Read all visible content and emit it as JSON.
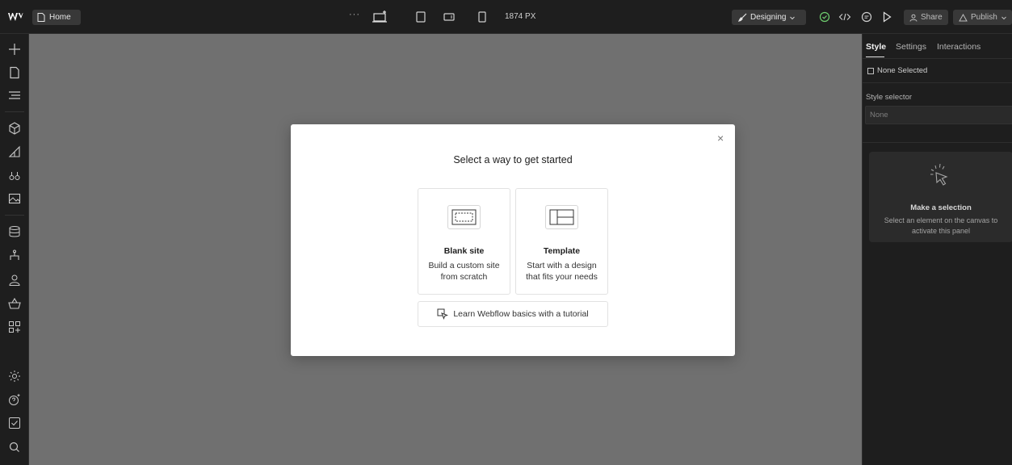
{
  "topbar": {
    "page_label": "Home",
    "more_label": "···",
    "viewport_width": "1874 PX",
    "mode_label": "Designing",
    "share_label": "Share",
    "publish_label": "Publish"
  },
  "modal": {
    "title": "Select a way to get started",
    "close_glyph": "×",
    "options": [
      {
        "title": "Blank site",
        "desc_line1": "Build a custom site",
        "desc_line2": "from scratch"
      },
      {
        "title": "Template",
        "desc_line1": "Start with a design",
        "desc_line2": "that fits your needs"
      }
    ],
    "tutorial_label": "Learn Webflow basics with a tutorial"
  },
  "right_panel": {
    "tabs": [
      "Style",
      "Settings",
      "Interactions"
    ],
    "none_selected": "None Selected",
    "style_selector_label": "Style selector",
    "style_selector_value": "None",
    "empty_title": "Make a selection",
    "empty_desc": "Select an element on the canvas to activate this panel"
  },
  "icons": {
    "left_sidebar": [
      "add-icon",
      "pages-icon",
      "navigator-icon",
      "components-icon",
      "styles-icon",
      "variables-icon",
      "assets-icon",
      "cms-icon",
      "logic-icon",
      "users-icon",
      "ecommerce-icon",
      "apps-icon",
      "settings-icon",
      "help-icon",
      "audit-icon",
      "search-icon"
    ]
  },
  "colors": {
    "canvas": "#707070",
    "chrome": "#1e1e1e",
    "modal": "#ffffff",
    "success": "#6fcf6f"
  }
}
